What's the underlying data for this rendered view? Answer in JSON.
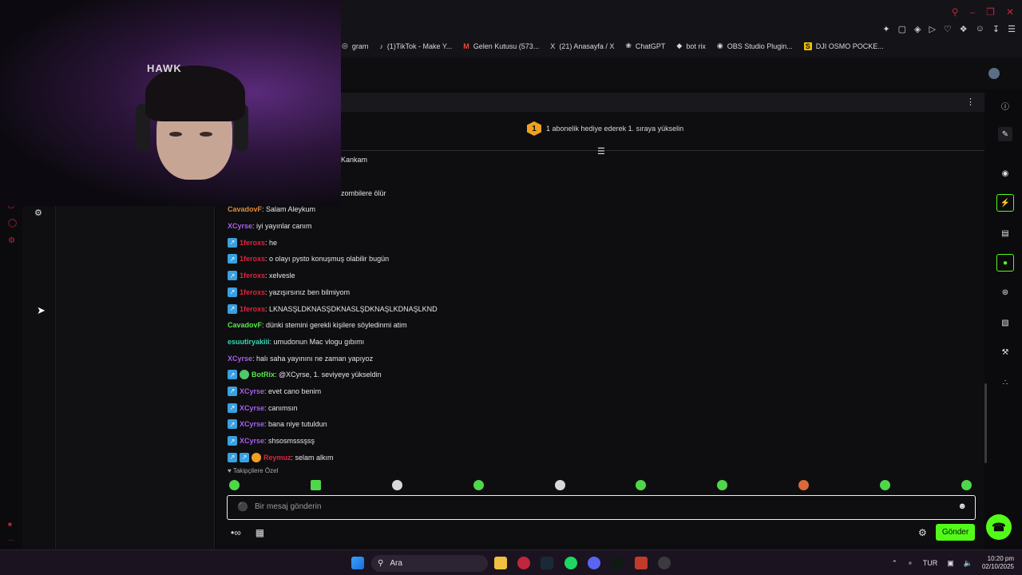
{
  "browser": {
    "bookmarks": [
      {
        "icon": "instagram-icon",
        "label": "gram"
      },
      {
        "icon": "tiktok-icon",
        "label": "(1)TikTok - Make Y..."
      },
      {
        "icon": "gmail-icon",
        "label": "Gelen Kutusu (573..."
      },
      {
        "icon": "x-icon",
        "label": "(21) Anasayfa / X"
      },
      {
        "icon": "chatgpt-icon",
        "label": "ChatGPT"
      },
      {
        "icon": "botrix-icon",
        "label": "bot rix"
      },
      {
        "icon": "obs-icon",
        "label": "OBS Studio Plugin..."
      },
      {
        "icon": "s-icon",
        "label": "DJI OSMO POCKE..."
      }
    ]
  },
  "webcam": {
    "cap_logo": "HAWK"
  },
  "chat": {
    "promo_rank": "1",
    "promo_text": "1 abonelik hediye ederek 1. sıraya yükselin",
    "messages": [
      {
        "badges": [],
        "user": "",
        "color": "c-white",
        "text": "Kankam"
      },
      {
        "badges": [],
        "user": "",
        "color": "c-white",
        "text": ""
      },
      {
        "badges": [],
        "user": "",
        "color": "c-white",
        "text": "zombilere ölür"
      },
      {
        "badges": [],
        "user": "CavadovF",
        "color": "c-orange",
        "text": ": Salam Aleykum"
      },
      {
        "badges": [],
        "user": "XCyrse",
        "color": "c-purple",
        "text": ": iyi yayınlar canım"
      },
      {
        "badges": [
          "sq"
        ],
        "user": "1feroxs",
        "color": "c-red",
        "text": ": he"
      },
      {
        "badges": [
          "sq"
        ],
        "user": "1feroxs",
        "color": "c-red",
        "text": ": o olayı pysto konuşmuş olabilir bugün"
      },
      {
        "badges": [
          "sq"
        ],
        "user": "1feroxs",
        "color": "c-red",
        "text": ": xelvesle"
      },
      {
        "badges": [
          "sq"
        ],
        "user": "1feroxs",
        "color": "c-red",
        "text": ": yazışırsınız ben bilmiyom"
      },
      {
        "badges": [
          "sq"
        ],
        "user": "1feroxs",
        "color": "c-red",
        "text": ": LKNASŞLDKNASŞDKNASLŞDKNAŞLKDNAŞLKND"
      },
      {
        "badges": [],
        "user": "CavadovF",
        "color": "c-green",
        "text": ": dünki stemini gerekli kişilere söyledinmi atim"
      },
      {
        "badges": [],
        "user": "esuutiryakiii",
        "color": "c-teal",
        "text": ": umudonun Mac vlogu gıbımı"
      },
      {
        "badges": [],
        "user": "XCyrse",
        "color": "c-purple",
        "text": ": halı saha yayınını ne zaman yapıyoz"
      },
      {
        "badges": [
          "sq",
          "g"
        ],
        "user": "BotRix",
        "color": "c-green",
        "text": ": @XCyrse, 1. seviyeye yükseldin"
      },
      {
        "badges": [
          "sq"
        ],
        "user": "XCyrse",
        "color": "c-purple",
        "text": ": evet cano benim"
      },
      {
        "badges": [
          "sq"
        ],
        "user": "XCyrse",
        "color": "c-purple",
        "text": ": canımsın"
      },
      {
        "badges": [
          "sq"
        ],
        "user": "XCyrse",
        "color": "c-purple",
        "text": ": bana niye tutuldun"
      },
      {
        "badges": [
          "sq"
        ],
        "user": "XCyrse",
        "color": "c-purple",
        "text": ": shsosmsssşsş"
      },
      {
        "badges": [
          "sq",
          "sq",
          "o"
        ],
        "user": "Reymuz",
        "color": "c-red",
        "text": ": selam alkım"
      }
    ],
    "followers_only": "Takipçilere Özel",
    "input_placeholder": "Bir mesaj gönderin",
    "send_label": "Gönder",
    "emote_count": 10
  },
  "taskbar": {
    "search_label": "Ara",
    "language": "TUR",
    "time": "10:20 pm",
    "date": "02/10/2025"
  },
  "colors": {
    "accent": "#53fc18",
    "brand_red": "#c0263d"
  }
}
